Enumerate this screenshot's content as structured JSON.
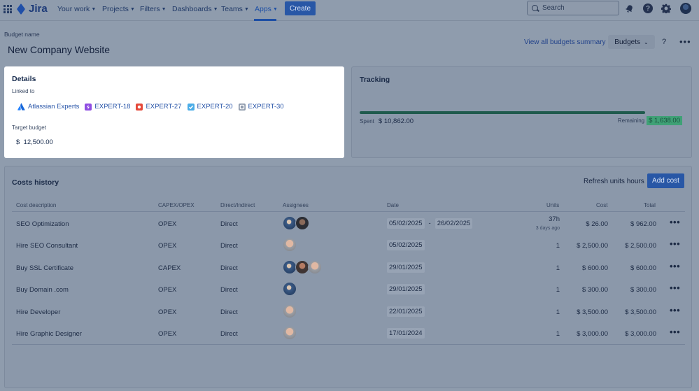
{
  "topnav": {
    "logo": "Jira",
    "items": [
      {
        "label": "Your work"
      },
      {
        "label": "Projects"
      },
      {
        "label": "Filters"
      },
      {
        "label": "Dashboards"
      },
      {
        "label": "Teams"
      },
      {
        "label": "Apps"
      }
    ],
    "active_item": "Apps",
    "create_label": "Create",
    "search_placeholder": "Search",
    "icons": [
      "apps-grid-icon",
      "bell-icon",
      "help-icon",
      "settings-icon",
      "avatar"
    ]
  },
  "header": {
    "budget_label": "Budget name",
    "title": "New Company Website",
    "view_summary": "View all budgets summary",
    "budgets_button": "Budgets",
    "help": "?",
    "more": "•••"
  },
  "details": {
    "title": "Details",
    "linked_label": "Linked to",
    "linked": [
      {
        "label": "Atlassian Experts",
        "icon": "atlassian-icon",
        "color": "#2684ff"
      },
      {
        "label": "EXPERT-18",
        "icon": "epic-icon",
        "color": "#904ee2"
      },
      {
        "label": "EXPERT-27",
        "icon": "bug-icon",
        "color": "#e5493a"
      },
      {
        "label": "EXPERT-20",
        "icon": "task-icon",
        "color": "#4bade8"
      },
      {
        "label": "EXPERT-30",
        "icon": "subtask-icon",
        "color": "#8f9bad"
      }
    ],
    "target_label": "Target budget",
    "target_value": "$  12,500.00"
  },
  "tracking": {
    "title": "Tracking",
    "spent_label": "Spent",
    "spent_value": "$ 10,862.00",
    "remaining_label": "Remaining",
    "remaining_value": "$ 1,638.00",
    "spent_fraction": 0.869,
    "bar_color": "#1f5a4d",
    "remaining_color": "#3fa176"
  },
  "costs": {
    "title": "Costs history",
    "refresh_label": "Refresh units hours",
    "add_label": "Add cost",
    "columns": [
      "Cost description",
      "CAPEX/OPEX",
      "Direct/Indirect",
      "Assignees",
      "Date",
      "Units",
      "Cost",
      "Total"
    ],
    "rows": [
      {
        "description": "SEO Optimization",
        "type": "OPEX",
        "direct": "Direct",
        "assignees": [
          "a",
          "b"
        ],
        "date": "05/02/2025",
        "date_sep": "-",
        "date_end": "26/02/2025",
        "units": "37h",
        "units_sub": "3 days ago",
        "cost": "$ 26.00",
        "total": "$ 962.00"
      },
      {
        "description": "Hire SEO Consultant",
        "type": "OPEX",
        "direct": "Direct",
        "assignees": [
          "c"
        ],
        "date": "05/02/2025",
        "date_sep": "",
        "date_end": "",
        "units": "1",
        "units_sub": "",
        "cost": "$ 2,500.00",
        "total": "$ 2,500.00"
      },
      {
        "description": "Buy SSL Certificate",
        "type": "CAPEX",
        "direct": "Direct",
        "assignees": [
          "a",
          "d",
          "c"
        ],
        "date": "29/01/2025",
        "date_sep": "",
        "date_end": "",
        "units": "1",
        "units_sub": "",
        "cost": "$ 600.00",
        "total": "$ 600.00"
      },
      {
        "description": "Buy Domain .com",
        "type": "OPEX",
        "direct": "Direct",
        "assignees": [
          "a"
        ],
        "date": "29/01/2025",
        "date_sep": "",
        "date_end": "",
        "units": "1",
        "units_sub": "",
        "cost": "$ 300.00",
        "total": "$ 300.00"
      },
      {
        "description": "Hire Developer",
        "type": "OPEX",
        "direct": "Direct",
        "assignees": [
          "c"
        ],
        "date": "22/01/2025",
        "date_sep": "",
        "date_end": "",
        "units": "1",
        "units_sub": "",
        "cost": "$ 3,500.00",
        "total": "$ 3,500.00"
      },
      {
        "description": "Hire Graphic Designer",
        "type": "OPEX",
        "direct": "Direct",
        "assignees": [
          "c"
        ],
        "date": "17/01/2024",
        "date_sep": "",
        "date_end": "",
        "units": "1",
        "units_sub": "",
        "cost": "$ 3,000.00",
        "total": "$ 3,000.00"
      }
    ],
    "row_more": "•••"
  }
}
